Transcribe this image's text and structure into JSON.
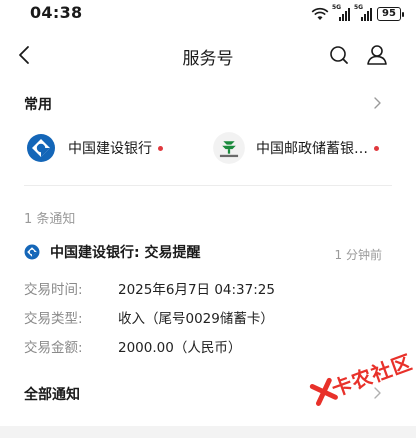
{
  "status_bar": {
    "time": "04:38",
    "signal_label_1": "5G",
    "signal_label_2": "5G",
    "battery": "95"
  },
  "nav": {
    "title": "服务号"
  },
  "common": {
    "title": "常用",
    "items": [
      {
        "name": "中国建设银行",
        "icon": "ccb-logo-icon",
        "has_dot": true
      },
      {
        "name": "中国邮政储蓄银…",
        "icon": "psbc-logo-icon",
        "has_dot": true
      }
    ]
  },
  "notifications": {
    "count_text": "1 条通知",
    "latest": {
      "title": "中国建设银行: 交易提醒",
      "time": "1 分钟前",
      "rows": [
        {
          "label": "交易时间:",
          "value": "2025年6月7日 04:37:25"
        },
        {
          "label": "交易类型:",
          "value": "收入（尾号0029储蓄卡）"
        },
        {
          "label": "交易金额:",
          "value": "2000.00（人民币）"
        }
      ]
    }
  },
  "all_notices": {
    "title": "全部通知"
  },
  "watermark": {
    "text": "卡农社区"
  },
  "colors": {
    "accent_red": "#e0393e",
    "ccb_blue": "#1466b8",
    "psbc_green": "#1a8a3c",
    "watermark_red": "#e8312a"
  }
}
